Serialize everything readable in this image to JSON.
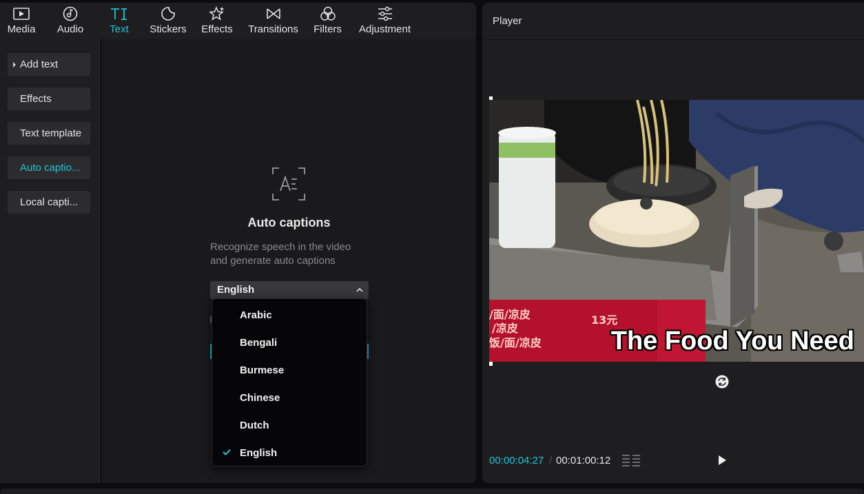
{
  "toolbar": {
    "tabs": [
      {
        "label": "Media",
        "icon": "media-icon"
      },
      {
        "label": "Audio",
        "icon": "audio-icon"
      },
      {
        "label": "Text",
        "icon": "text-icon"
      },
      {
        "label": "Stickers",
        "icon": "stickers-icon"
      },
      {
        "label": "Effects",
        "icon": "effects-icon"
      },
      {
        "label": "Transitions",
        "icon": "transitions-icon"
      },
      {
        "label": "Filters",
        "icon": "filters-icon"
      },
      {
        "label": "Adjustment",
        "icon": "adjustment-icon"
      }
    ],
    "active_tab": "Text"
  },
  "sidebar": {
    "items": [
      {
        "label": "Add text"
      },
      {
        "label": "Effects"
      },
      {
        "label": "Text template"
      },
      {
        "label": "Auto captio..."
      },
      {
        "label": "Local capti..."
      }
    ],
    "active_item": "Auto captio..."
  },
  "auto_captions": {
    "icon": "auto-captions-icon",
    "title": "Auto captions",
    "description_line1": "Recognize speech in the video",
    "description_line2": "and generate auto captions",
    "selected_language": "English",
    "options": [
      "Arabic",
      "Bengali",
      "Burmese",
      "Chinese",
      "Dutch",
      "English"
    ],
    "checked_option": "English"
  },
  "player": {
    "title": "Player",
    "video_caption": "The Food You Need",
    "sign_text": [
      "/面/凉皮",
      "/凉皮",
      "13元",
      "饭/面/凉皮"
    ],
    "current_time": "00:00:04:27",
    "separator": "/",
    "total_time": "00:01:00:12"
  },
  "colors": {
    "accent": "#22c4d6",
    "panel": "#1e1e20",
    "background": "#0c0c0e",
    "dropdown": "#060608"
  }
}
